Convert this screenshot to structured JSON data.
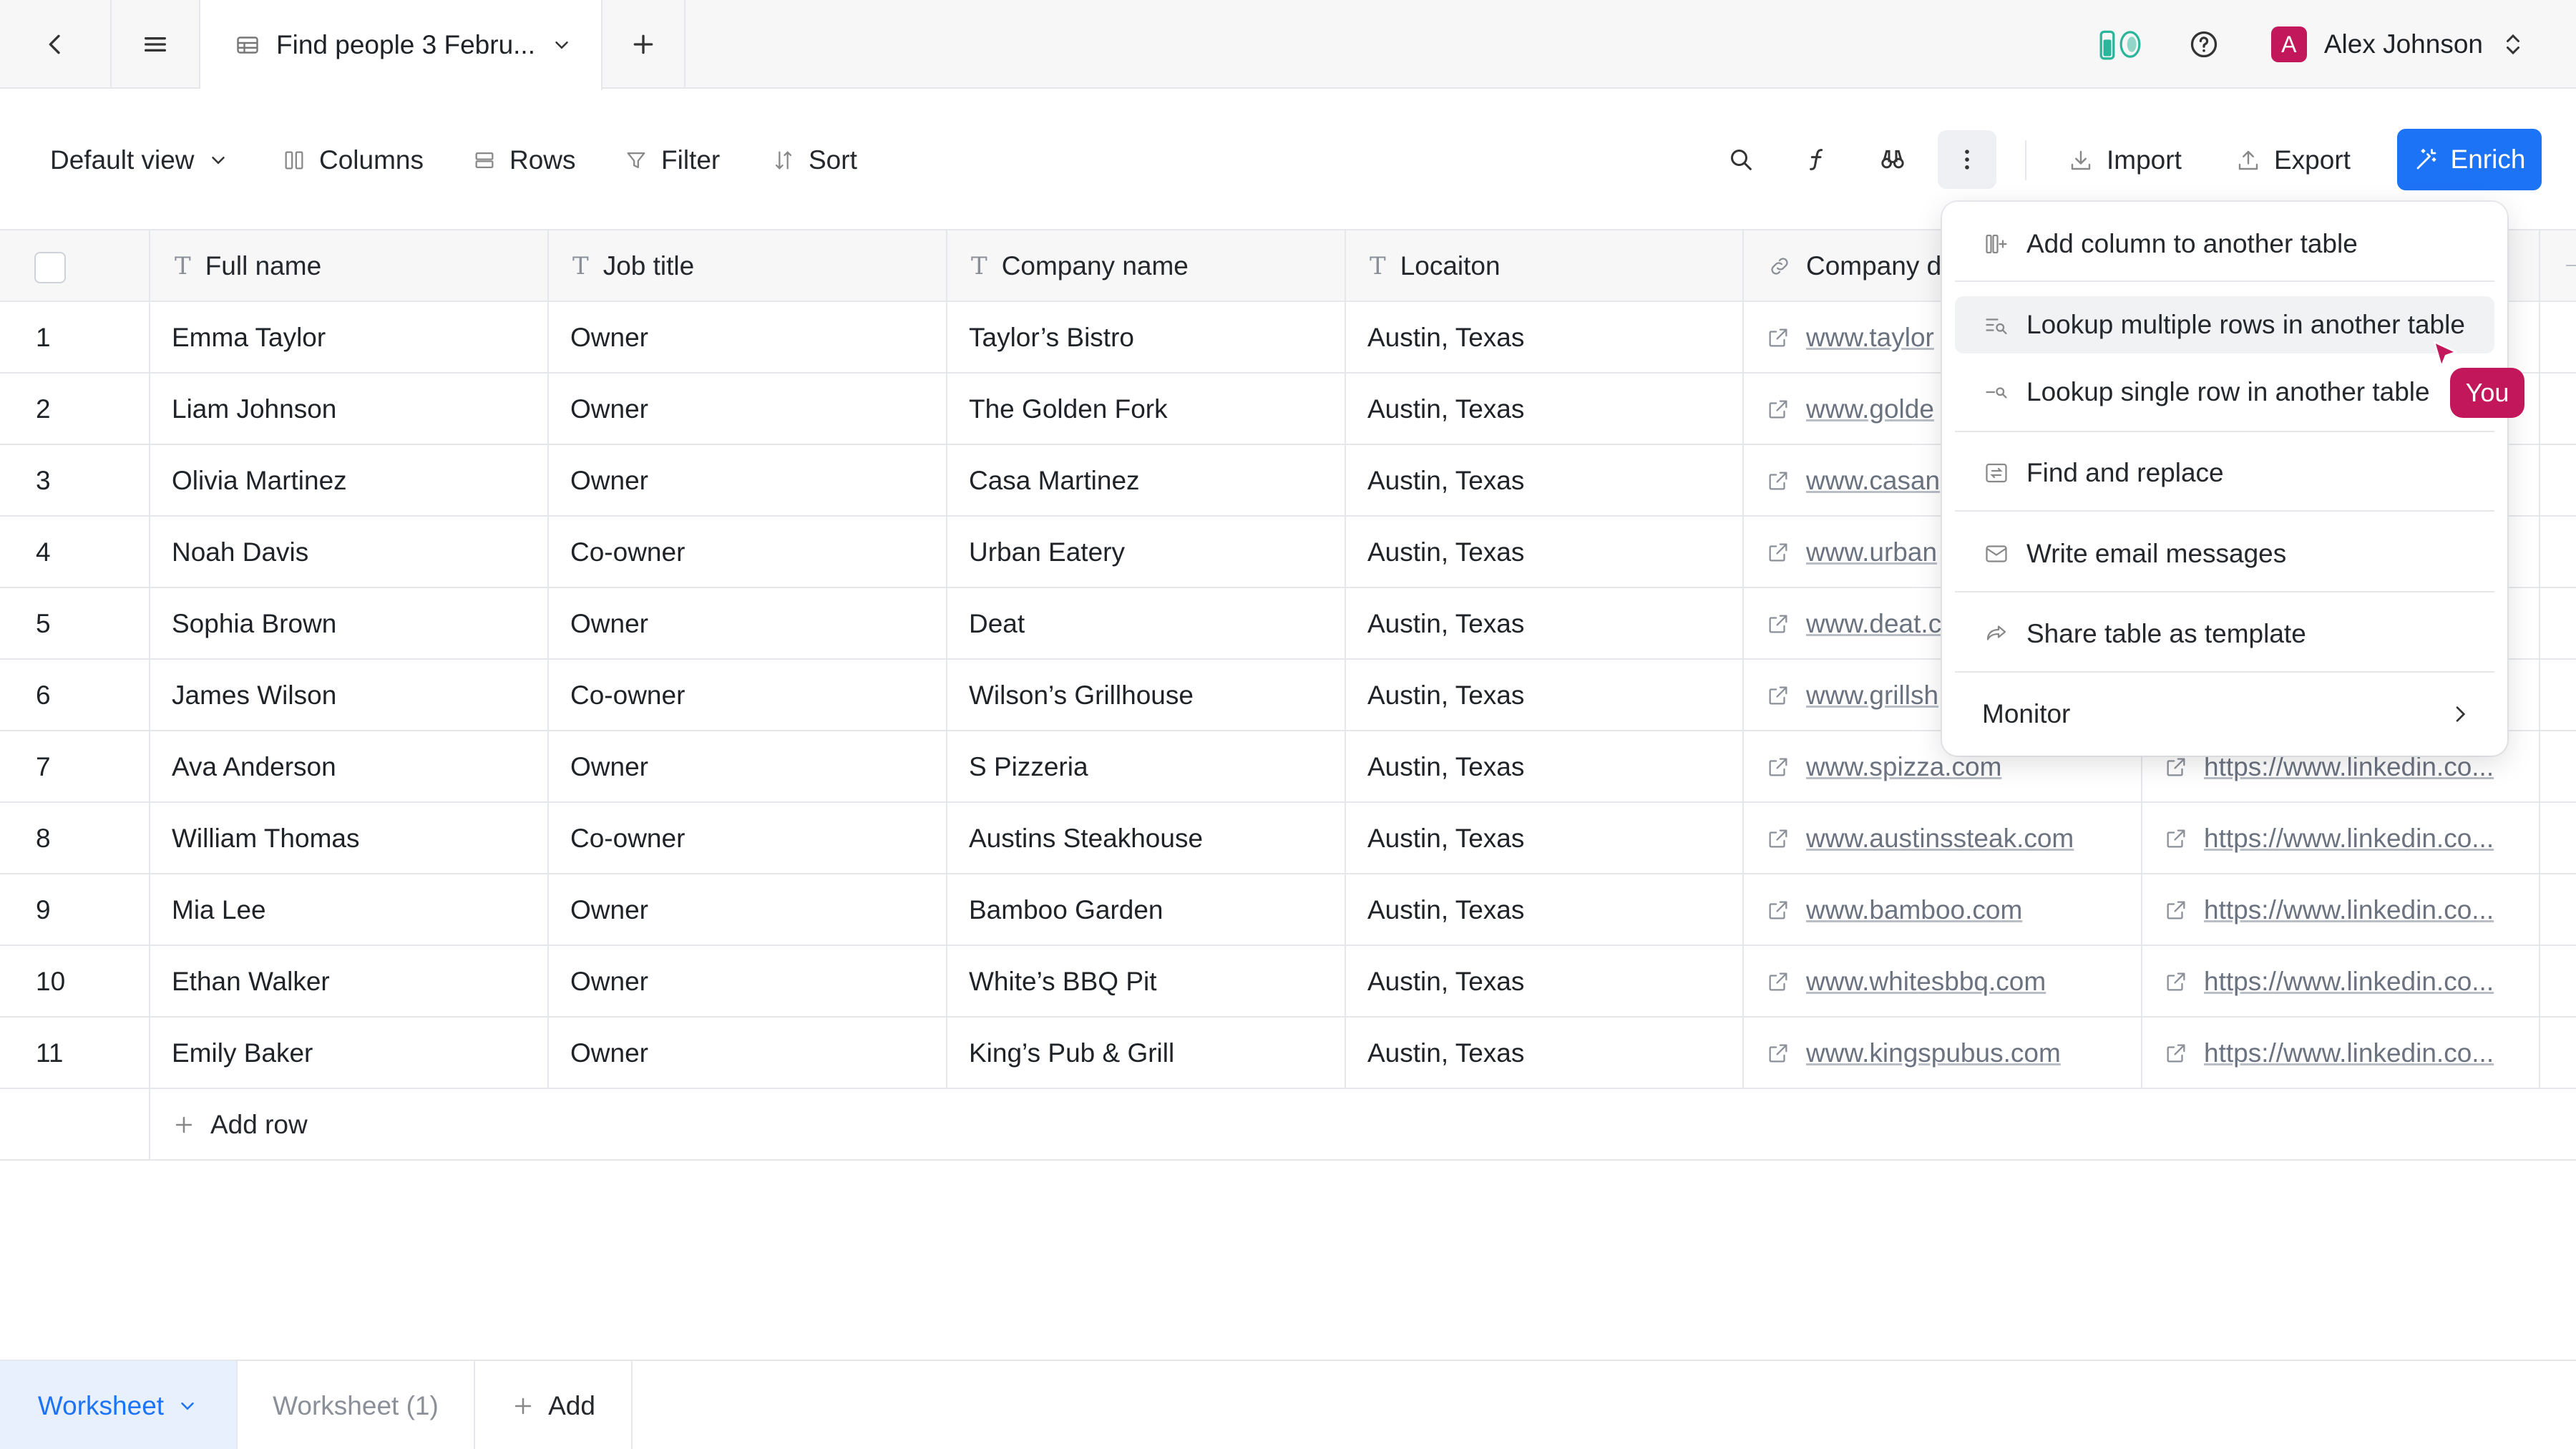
{
  "tab": {
    "title": "Find people 3 Febru..."
  },
  "user": {
    "initial": "A",
    "name": "Alex Johnson"
  },
  "toolbar": {
    "view": "Default view",
    "columns": "Columns",
    "rows": "Rows",
    "filter": "Filter",
    "sort": "Sort",
    "import": "Import",
    "export": "Export",
    "enrich": "Enrich"
  },
  "table": {
    "headers": [
      "Full name",
      "Job title",
      "Company name",
      "Locaiton",
      "Company d"
    ],
    "rows": [
      {
        "n": "1",
        "name": "Emma Taylor",
        "title": "Owner",
        "company": "Taylor’s Bistro",
        "loc": "Austin, Texas",
        "domain": "www.taylor",
        "li": ""
      },
      {
        "n": "2",
        "name": "Liam Johnson",
        "title": "Owner",
        "company": "The Golden Fork",
        "loc": "Austin, Texas",
        "domain": "www.golde",
        "li": ""
      },
      {
        "n": "3",
        "name": "Olivia Martinez",
        "title": "Owner",
        "company": "Casa Martinez",
        "loc": "Austin, Texas",
        "domain": "www.casan",
        "li": ""
      },
      {
        "n": "4",
        "name": "Noah Davis",
        "title": "Co-owner",
        "company": "Urban Eatery",
        "loc": "Austin, Texas",
        "domain": "www.urban",
        "li": ""
      },
      {
        "n": "5",
        "name": "Sophia Brown",
        "title": "Owner",
        "company": "Deat",
        "loc": "Austin, Texas",
        "domain": "www.deat.c",
        "li": ""
      },
      {
        "n": "6",
        "name": "James Wilson",
        "title": "Co-owner",
        "company": "Wilson’s Grillhouse",
        "loc": "Austin, Texas",
        "domain": "www.grillsh",
        "li": ""
      },
      {
        "n": "7",
        "name": "Ava Anderson",
        "title": "Owner",
        "company": "S Pizzeria",
        "loc": "Austin, Texas",
        "domain": "www.spizza.com",
        "li": "https://www.linkedin.co..."
      },
      {
        "n": "8",
        "name": "William Thomas",
        "title": "Co-owner",
        "company": "Austins Steakhouse",
        "loc": "Austin, Texas",
        "domain": "www.austinssteak.com",
        "li": "https://www.linkedin.co..."
      },
      {
        "n": "9",
        "name": "Mia Lee",
        "title": "Owner",
        "company": "Bamboo Garden",
        "loc": "Austin, Texas",
        "domain": "www.bamboo.com",
        "li": "https://www.linkedin.co..."
      },
      {
        "n": "10",
        "name": "Ethan Walker",
        "title": "Owner",
        "company": "White’s BBQ Pit",
        "loc": "Austin, Texas",
        "domain": "www.whitesbbq.com",
        "li": "https://www.linkedin.co..."
      },
      {
        "n": "11",
        "name": "Emily Baker",
        "title": "Owner",
        "company": "King’s Pub & Grill",
        "loc": "Austin, Texas",
        "domain": "www.kingspubus.com",
        "li": "https://www.linkedin.co..."
      }
    ],
    "add_row": "Add row"
  },
  "menu": {
    "add_column": "Add column to another table",
    "lookup_multiple": "Lookup multiple rows in another table",
    "lookup_single": "Lookup single row in another table",
    "find_replace": "Find and replace",
    "write_email": "Write email messages",
    "share_template": "Share table as template",
    "monitor": "Monitor"
  },
  "cursor_label": "You",
  "sheets": {
    "active": "Worksheet",
    "other": "Worksheet (1)",
    "add": "Add"
  },
  "colors": {
    "accent": "#1d73f5",
    "brand": "#c2185b"
  }
}
